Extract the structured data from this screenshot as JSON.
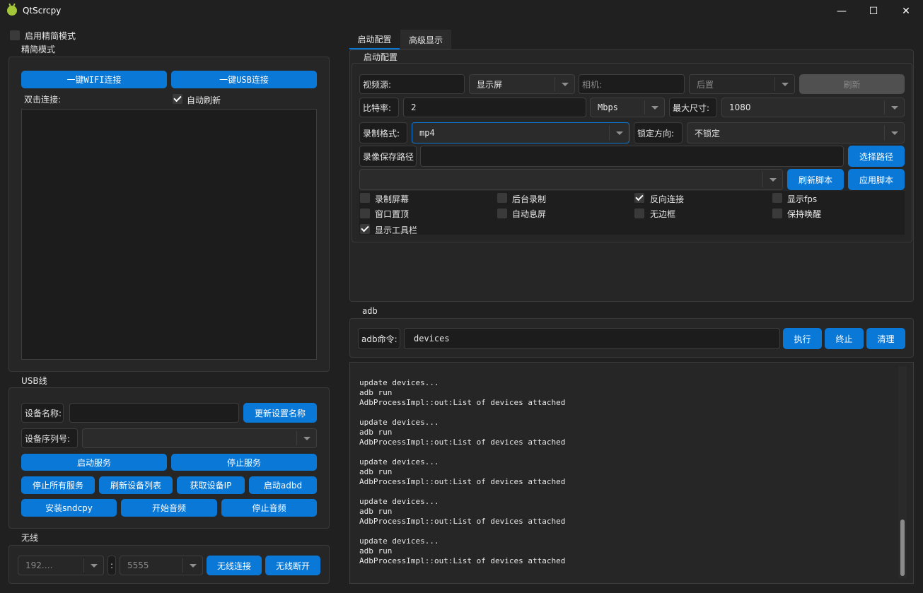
{
  "window": {
    "title": "QtScrcpy",
    "minimize": "—",
    "maximize": "☐",
    "close": "✕"
  },
  "left": {
    "simple_mode_label": "启用精简模式",
    "simple_group_title": "精简模式",
    "wifi_connect": "一键WIFI连接",
    "usb_connect": "一键USB连接",
    "double_click_connect": "双击连接:",
    "auto_refresh": "自动刷新",
    "usb_group_title": "USB线",
    "device_name_label": "设备名称:",
    "device_name_value": "",
    "update_name_btn": "更新设置名称",
    "serial_label": "设备序列号:",
    "start_service": "启动服务",
    "stop_service": "停止服务",
    "stop_all": "停止所有服务",
    "refresh_devices": "刷新设备列表",
    "get_ip": "获取设备IP",
    "start_adbd": "启动adbd",
    "install_sndcpy": "安装sndcpy",
    "start_audio": "开始音频",
    "stop_audio": "停止音频",
    "wireless_group_title": "无线",
    "ip_value": "192.…",
    "colon": ":",
    "port_value": "5555",
    "wireless_connect": "无线连接",
    "wireless_disconnect": "无线断开"
  },
  "tabs": [
    {
      "label": "启动配置"
    },
    {
      "label": "高级显示"
    }
  ],
  "config": {
    "group_title": "启动配置",
    "video_source_label": "视频源:",
    "video_source_value": "显示屏",
    "camera_placeholder": "相机:",
    "camera_position": "后置",
    "refresh_btn": "刷新",
    "bitrate_label": "比特率:",
    "bitrate_value": "2",
    "bitrate_unit": "Mbps",
    "max_size_label": "最大尺寸:",
    "max_size_value": "1080",
    "record_format_label": "录制格式:",
    "record_format_value": "mp4",
    "lock_orientation_label": "锁定方向:",
    "lock_orientation_value": "不锁定",
    "record_path_label": "录像保存路径",
    "record_path_value": "",
    "choose_path_btn": "选择路径",
    "refresh_script_btn": "刷新脚本",
    "apply_script_btn": "应用脚本",
    "options": [
      {
        "label": "录制屏幕",
        "checked": false
      },
      {
        "label": "后台录制",
        "checked": false
      },
      {
        "label": "反向连接",
        "checked": true
      },
      {
        "label": "显示fps",
        "checked": false
      },
      {
        "label": "窗口置顶",
        "checked": false
      },
      {
        "label": "自动息屏",
        "checked": false
      },
      {
        "label": "无边框",
        "checked": false
      },
      {
        "label": "保持唤醒",
        "checked": false
      },
      {
        "label": "显示工具栏",
        "checked": true
      }
    ]
  },
  "adb": {
    "group_title": "adb",
    "command_label": "adb命令:",
    "command_value": "devices",
    "execute_btn": "执行",
    "stop_btn": "终止",
    "clear_btn": "清理"
  },
  "log": "update devices...\nadb run\nAdbProcessImpl::out:List of devices attached\n\nupdate devices...\nadb run\nAdbProcessImpl::out:List of devices attached\n\nupdate devices...\nadb run\nAdbProcessImpl::out:List of devices attached\n\nupdate devices...\nadb run\nAdbProcessImpl::out:List of devices attached\n\nupdate devices...\nadb run\nAdbProcessImpl::out:List of devices attached",
  "colors": {
    "accent": "#0a78d7",
    "background": "#202020",
    "panel": "#1c1c1c"
  }
}
